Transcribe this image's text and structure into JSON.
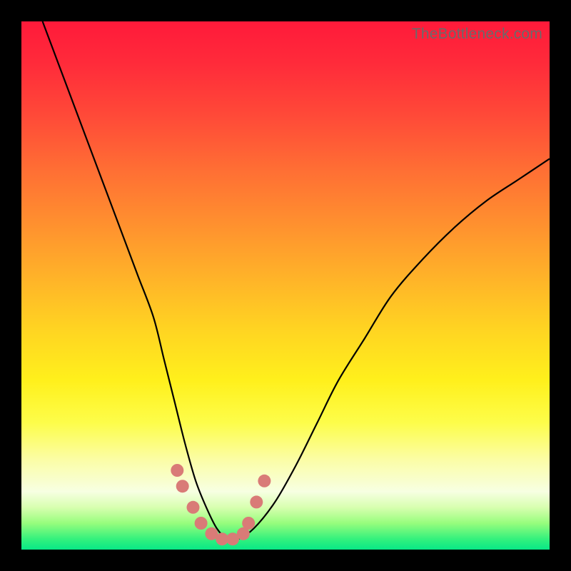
{
  "watermark_text": "TheBottleneck.com",
  "colors": {
    "frame_bg": "#000000",
    "curve_stroke": "#000000",
    "marker_fill": "#d97b77",
    "gradient_top": "#ff1a3a",
    "gradient_bottom": "#08e886"
  },
  "chart_data": {
    "type": "line",
    "title": "",
    "xlabel": "",
    "ylabel": "",
    "xlim": [
      0,
      100
    ],
    "ylim": [
      0,
      100
    ],
    "note": "y-axis value represents approximate vertical position of the curve as a percentage from the bottom (0 = bottom/green, 100 = top/red). x-axis is horizontal position as percentage of plot width.",
    "series": [
      {
        "name": "bottleneck-curve",
        "x": [
          4,
          7,
          10,
          13,
          16,
          19,
          22,
          25,
          27,
          29,
          31,
          33,
          35,
          37,
          39,
          41,
          44,
          48,
          52,
          56,
          60,
          65,
          70,
          76,
          82,
          88,
          94,
          100
        ],
        "y": [
          100,
          92,
          84,
          76,
          68,
          60,
          52,
          44,
          36,
          28,
          20,
          13,
          8,
          4,
          2,
          2,
          4,
          9,
          16,
          24,
          32,
          40,
          48,
          55,
          61,
          66,
          70,
          74
        ]
      }
    ],
    "markers": {
      "name": "highlight-points",
      "note": "red/pink dots near the curve minimum",
      "x": [
        29.5,
        30.5,
        32.5,
        34.0,
        36.0,
        38.0,
        40.0,
        42.0,
        43.0,
        44.5,
        46.0
      ],
      "y": [
        15,
        12,
        8,
        5,
        3,
        2,
        2,
        3,
        5,
        9,
        13
      ]
    }
  }
}
